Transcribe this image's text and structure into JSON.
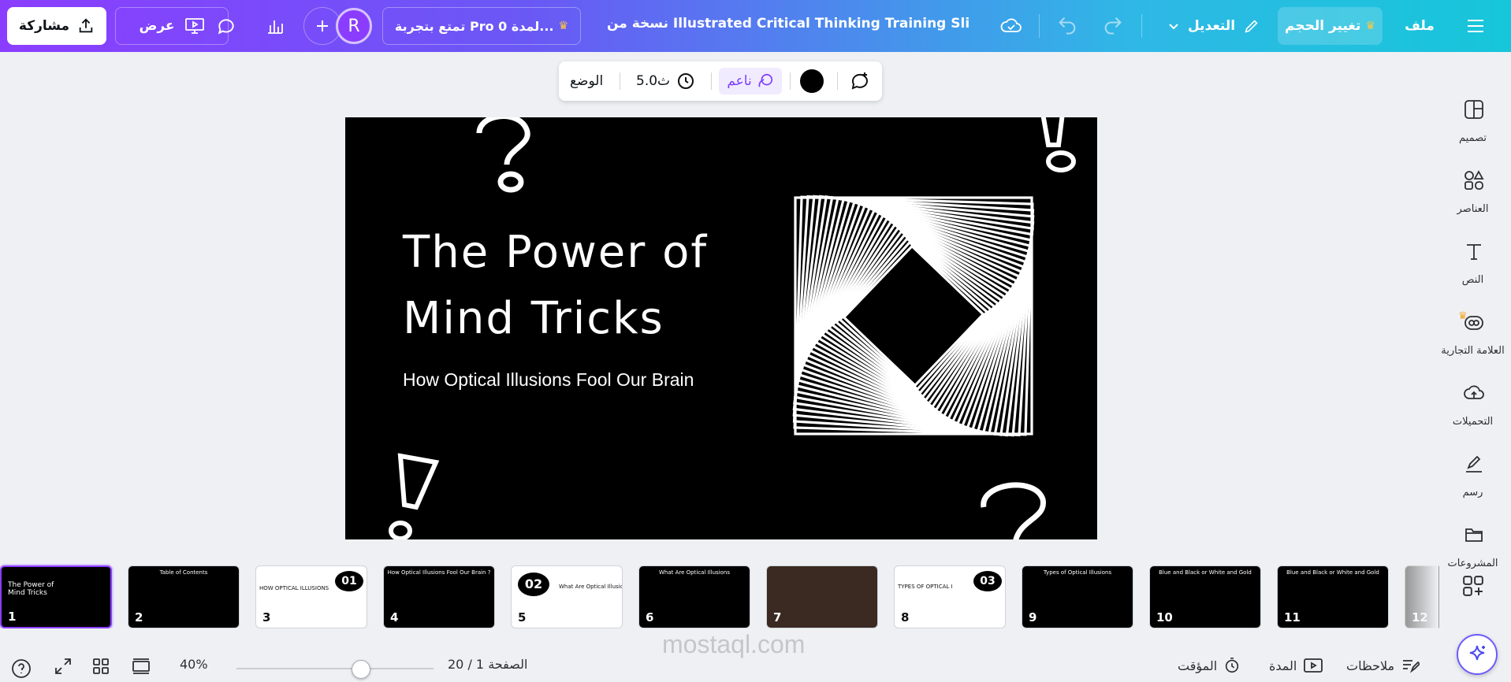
{
  "topbar": {
    "share_label": "مشاركة",
    "present_label": "عرض",
    "avatar_initial": "R",
    "trial_label": "تمتع بتجربة Pro لمدة 0...",
    "document_title": "نسخة من Illustrated Critical Thinking Training Slides ...",
    "edit_label": "التعديل",
    "resize_label": "تغيير الحجم",
    "file_label": "ملف"
  },
  "sidebar": {
    "items": [
      {
        "label": "تصميم",
        "icon": "design-icon"
      },
      {
        "label": "العناصر",
        "icon": "elements-icon"
      },
      {
        "label": "النص",
        "icon": "text-icon"
      },
      {
        "label": "العلامة التجارية",
        "icon": "brand-icon"
      },
      {
        "label": "التحميلات",
        "icon": "upload-icon"
      },
      {
        "label": "رسم",
        "icon": "draw-icon"
      },
      {
        "label": "المشروعات",
        "icon": "folder-icon"
      }
    ]
  },
  "floating_toolbar": {
    "position_label": "الوضع",
    "duration_label": "5.0ث",
    "transition_label": "ناعم"
  },
  "slide": {
    "title": "The Power of Mind Tricks",
    "subtitle": "How Optical Illusions Fool Our Brain"
  },
  "thumbnails": [
    {
      "num": "1",
      "caption": "The Power of Mind Tricks",
      "theme": "black",
      "active": true
    },
    {
      "num": "2",
      "caption": "Table of Contents",
      "theme": "black"
    },
    {
      "num": "3",
      "caption": "HOW OPTICAL ILLUSIONS FOOL OUR BRAIN ?",
      "theme": "white",
      "badge": "01"
    },
    {
      "num": "4",
      "caption": "How Optical Illusions Fool Our Brain ?",
      "theme": "black"
    },
    {
      "num": "5",
      "caption": "What Are Optical Illusions ?",
      "theme": "white",
      "badge": "02"
    },
    {
      "num": "6",
      "caption": "What Are Optical Illusions",
      "theme": "black"
    },
    {
      "num": "7",
      "caption": "",
      "theme": "black"
    },
    {
      "num": "8",
      "caption": "TYPES OF OPTICAL ILLUSIONS",
      "theme": "white",
      "badge": "03"
    },
    {
      "num": "9",
      "caption": "Types of Optical Illusions",
      "theme": "black"
    },
    {
      "num": "10",
      "caption": "Blue and Black or White and Gold",
      "theme": "black"
    },
    {
      "num": "11",
      "caption": "Blue and Black or White and Gold",
      "theme": "black"
    },
    {
      "num": "12",
      "caption": "",
      "theme": "gray"
    }
  ],
  "bottombar": {
    "zoom": "40%",
    "page_indicator": "الصفحة 1 / 20",
    "timer_label": "المؤقت",
    "duration_label": "المدة",
    "notes_label": "ملاحظات"
  },
  "watermark": "mostaql.com",
  "colors": {
    "accent": "#8b3dff",
    "gradient_start": "#8b3dff",
    "gradient_end": "#16c6d9"
  }
}
